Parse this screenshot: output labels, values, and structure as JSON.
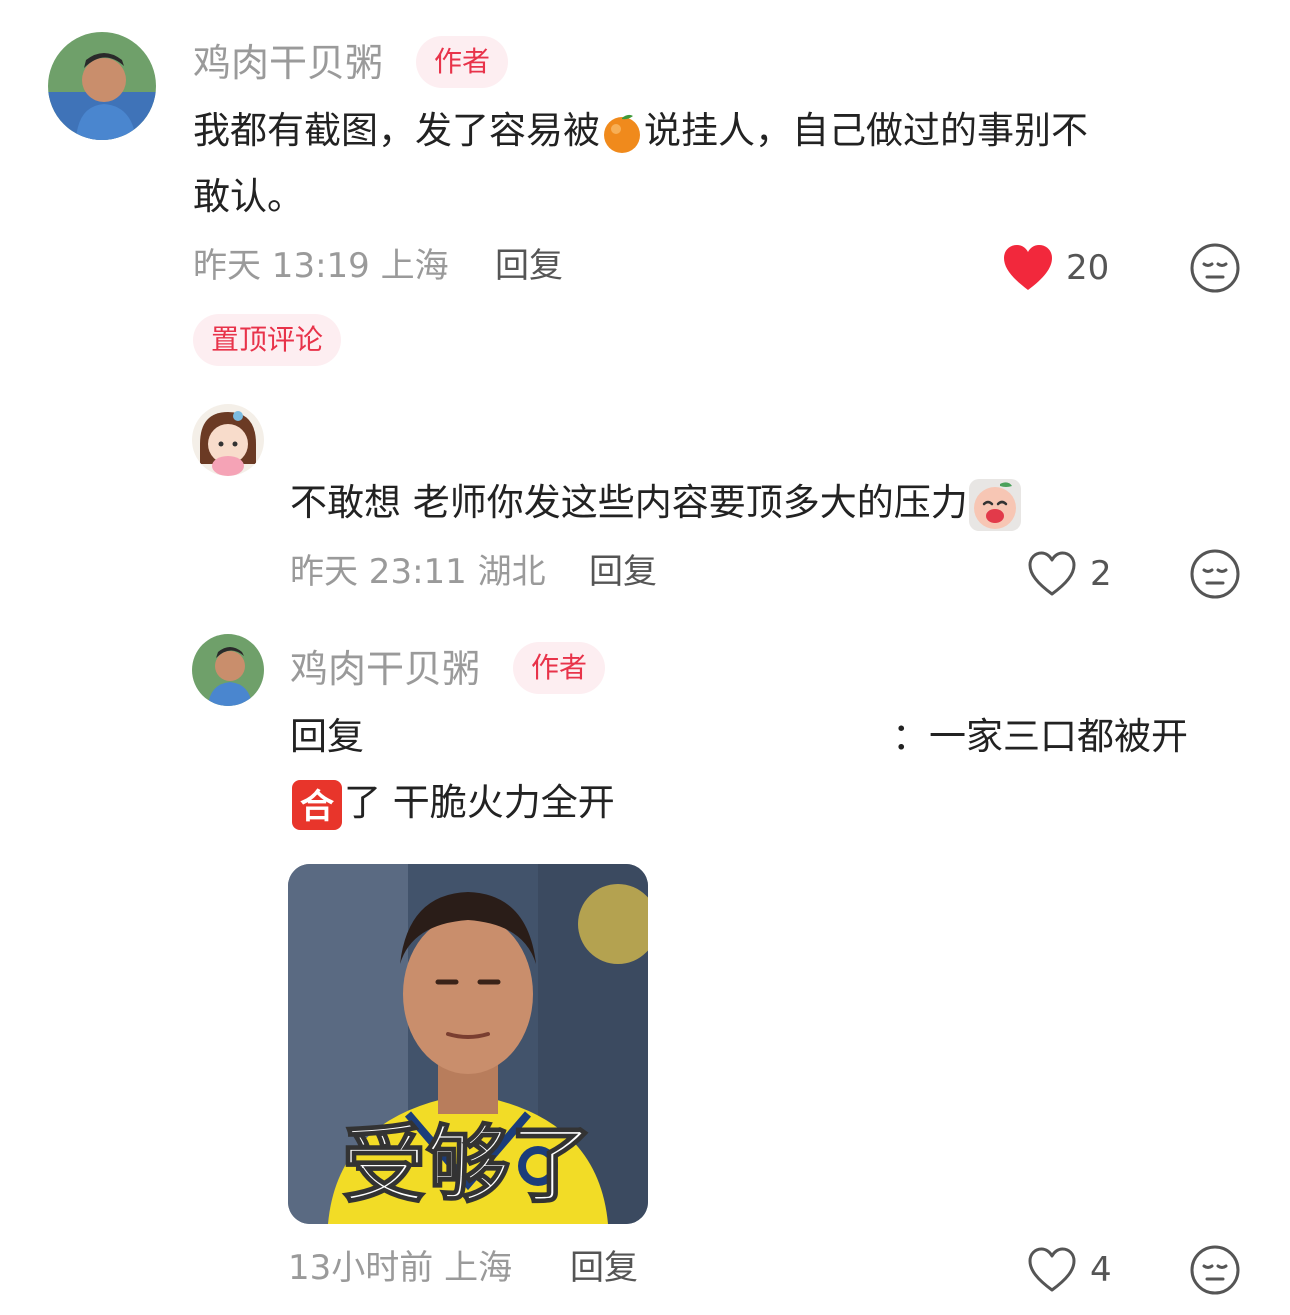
{
  "comments": [
    {
      "username": "鸡肉干贝粥",
      "badge": "作者",
      "text_part1": "我都有截图，发了容易被",
      "text_part2": "说挂人，自己做过的事别不",
      "text_line2": "敢认。",
      "time": "昨天 13:19 上海",
      "reply_label": "回复",
      "like_count": "20",
      "liked": true,
      "pinned_label": "置顶评论"
    },
    {
      "text": "不敢想 老师你发这些内容要顶多大的压力",
      "time": "昨天 23:11 湖北",
      "reply_label": "回复",
      "like_count": "2",
      "liked": false
    },
    {
      "username": "鸡肉干贝粥",
      "badge": "作者",
      "reply_prefix": "回复",
      "reply_rest": "：一家三口都被开",
      "text_line2": "了 干脆火力全开",
      "sticker_caption": "受够了",
      "time": "13小时前 上海",
      "reply_label": "回复",
      "like_count": "4",
      "liked": false
    }
  ],
  "icons": {
    "heart_filled": "heart-filled-icon",
    "heart_outline": "heart-outline-icon",
    "dislike": "meh-face-icon",
    "orange_emoji": "orange-emoji",
    "crying_emoji": "crying-face-emoji",
    "he_emoji": "合"
  },
  "colors": {
    "accent": "#e8334a",
    "badge_bg": "#fdeef1",
    "muted": "#9a9a9a"
  }
}
